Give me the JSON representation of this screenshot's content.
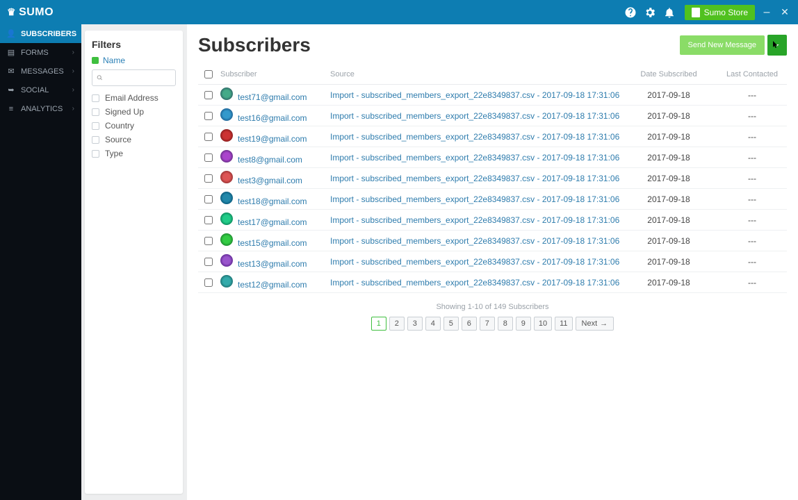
{
  "topbar": {
    "brand": "SUMO",
    "store_label": "Sumo Store"
  },
  "nav": {
    "items": [
      {
        "label": "SUBSCRIBERS",
        "icon": "person"
      },
      {
        "label": "FORMS",
        "icon": "doc"
      },
      {
        "label": "MESSAGES",
        "icon": "mail"
      },
      {
        "label": "SOCIAL",
        "icon": "share"
      },
      {
        "label": "ANALYTICS",
        "icon": "graph"
      }
    ]
  },
  "filters": {
    "title": "Filters",
    "name_label": "Name",
    "search_placeholder": "",
    "options": [
      "Email Address",
      "Signed Up",
      "Country",
      "Source",
      "Type"
    ]
  },
  "main": {
    "title": "Subscribers",
    "send_label": "Send New Message",
    "columns": {
      "subscriber": "Subscriber",
      "source": "Source",
      "date": "Date Subscribed",
      "last": "Last Contacted"
    },
    "rows": [
      {
        "email": "test71@gmail.com",
        "source": "Import - subscribed_members_export_22e8349837.csv - 2017-09-18 17:31:06",
        "date": "2017-09-18",
        "last": "---"
      },
      {
        "email": "test16@gmail.com",
        "source": "Import - subscribed_members_export_22e8349837.csv - 2017-09-18 17:31:06",
        "date": "2017-09-18",
        "last": "---"
      },
      {
        "email": "test19@gmail.com",
        "source": "Import - subscribed_members_export_22e8349837.csv - 2017-09-18 17:31:06",
        "date": "2017-09-18",
        "last": "---"
      },
      {
        "email": "test8@gmail.com",
        "source": "Import - subscribed_members_export_22e8349837.csv - 2017-09-18 17:31:06",
        "date": "2017-09-18",
        "last": "---"
      },
      {
        "email": "test3@gmail.com",
        "source": "Import - subscribed_members_export_22e8349837.csv - 2017-09-18 17:31:06",
        "date": "2017-09-18",
        "last": "---"
      },
      {
        "email": "test18@gmail.com",
        "source": "Import - subscribed_members_export_22e8349837.csv - 2017-09-18 17:31:06",
        "date": "2017-09-18",
        "last": "---"
      },
      {
        "email": "test17@gmail.com",
        "source": "Import - subscribed_members_export_22e8349837.csv - 2017-09-18 17:31:06",
        "date": "2017-09-18",
        "last": "---"
      },
      {
        "email": "test15@gmail.com",
        "source": "Import - subscribed_members_export_22e8349837.csv - 2017-09-18 17:31:06",
        "date": "2017-09-18",
        "last": "---"
      },
      {
        "email": "test13@gmail.com",
        "source": "Import - subscribed_members_export_22e8349837.csv - 2017-09-18 17:31:06",
        "date": "2017-09-18",
        "last": "---"
      },
      {
        "email": "test12@gmail.com",
        "source": "Import - subscribed_members_export_22e8349837.csv - 2017-09-18 17:31:06",
        "date": "2017-09-18",
        "last": "---"
      }
    ],
    "showing": "Showing 1-10 of 149 Subscribers",
    "pages": [
      "1",
      "2",
      "3",
      "4",
      "5",
      "6",
      "7",
      "8",
      "9",
      "10",
      "11"
    ],
    "next_label": "Next"
  }
}
